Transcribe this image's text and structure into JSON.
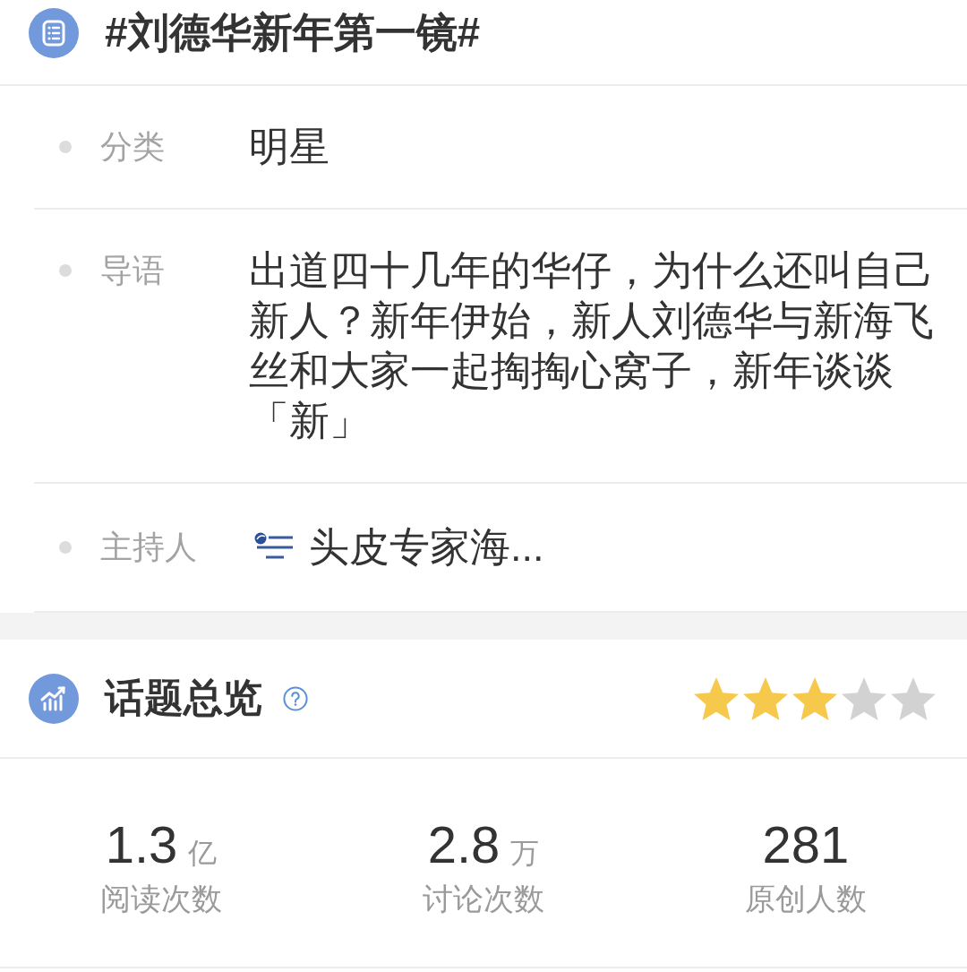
{
  "topic": {
    "title": "#刘德华新年第一镜#"
  },
  "details": [
    {
      "kind": "text",
      "label": "分类",
      "value": "明星"
    },
    {
      "kind": "text",
      "label": "导语",
      "value": "出道四十几年的华仔，为什么还叫自己新人？新年伊始，新人刘德华与新海飞丝和大家一起掏掏心窝子，新年谈谈「新」"
    },
    {
      "kind": "host",
      "label": "主持人",
      "value": "头皮专家海..."
    }
  ],
  "overview": {
    "title": "话题总览",
    "stars": 3,
    "stats": [
      {
        "value": "1.3",
        "unit": "亿",
        "label": "阅读次数"
      },
      {
        "value": "2.8",
        "unit": "万",
        "label": "讨论次数"
      },
      {
        "value": "281",
        "label": "原创人数"
      }
    ]
  }
}
